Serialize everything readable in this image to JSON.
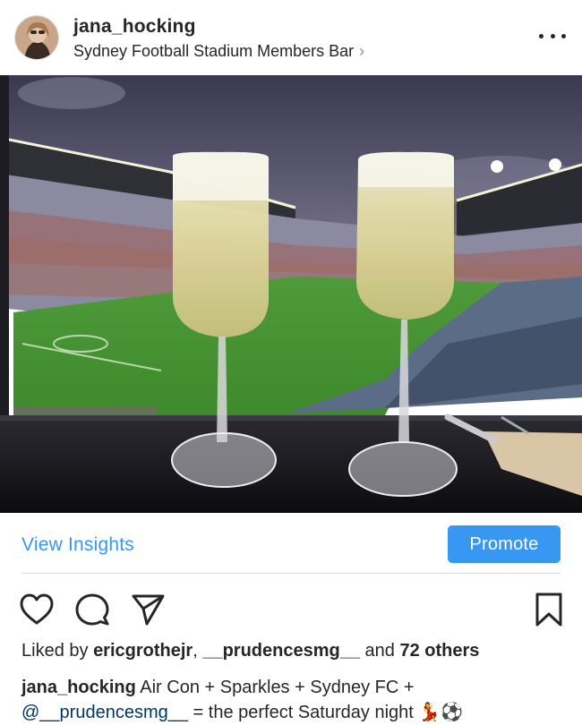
{
  "header": {
    "username": "jana_hocking",
    "location": "Sydney Football Stadium Members Bar",
    "location_chevron": "›",
    "more_icon": "more-horizontal-icon"
  },
  "photo": {
    "icon": "post-photo"
  },
  "insights": {
    "view_label": "View Insights",
    "promote_label": "Promote"
  },
  "actions": {
    "like_icon": "heart-icon",
    "comment_icon": "comment-icon",
    "share_icon": "send-icon",
    "save_icon": "bookmark-icon"
  },
  "likes": {
    "prefix": "Liked by ",
    "user1": "ericgrothejr",
    "sep": ", ",
    "user2": "__prudencesmg__",
    "and": " and ",
    "others": "72 others"
  },
  "caption": {
    "username": "jana_hocking",
    "text": " Air Con + Sparkles + Sydney FC +",
    "mention": "@__prudencesmg__",
    "text2": " = the perfect Saturday night ",
    "emoji": "💃⚽"
  },
  "colors": {
    "accent": "#3897f0",
    "text": "#262626",
    "divider": "#dbdbdb"
  }
}
